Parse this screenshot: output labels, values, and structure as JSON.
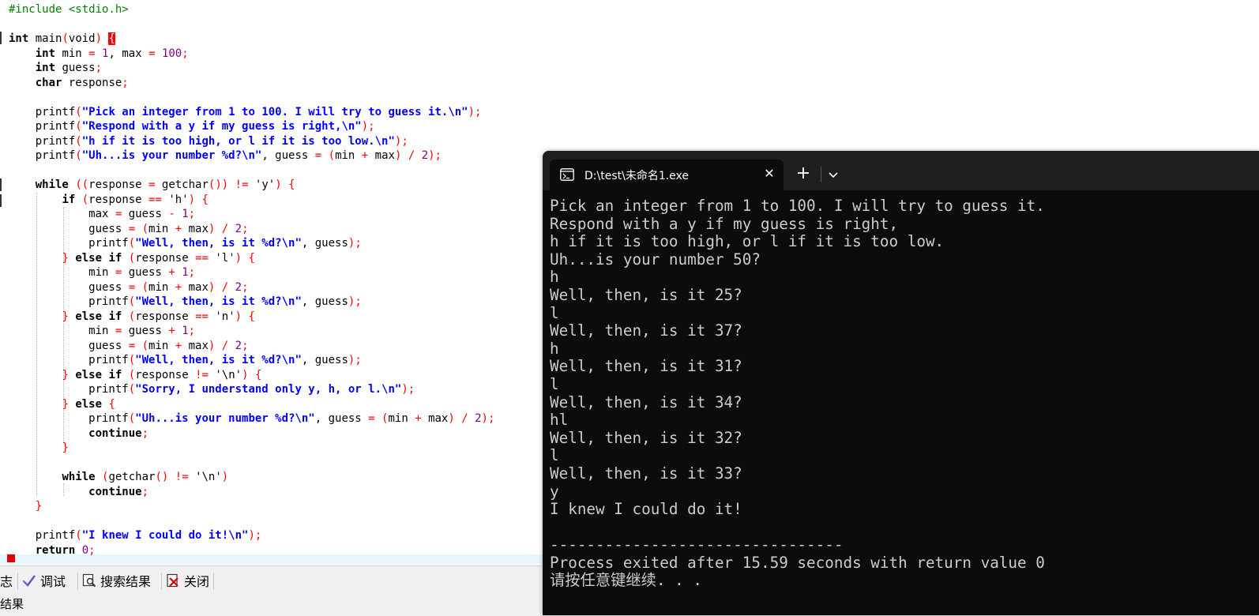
{
  "editor": {
    "lines": [
      [
        {
          "t": "#include <stdio.h>",
          "c": "pp"
        }
      ],
      [],
      [
        {
          "t": "int",
          "c": "kw"
        },
        {
          "t": " main"
        },
        {
          "t": "(",
          "c": "br"
        },
        {
          "t": "void"
        },
        {
          "t": ")",
          "c": "br"
        },
        {
          "t": " "
        },
        {
          "t": "{",
          "c": "brace-hl"
        }
      ],
      [
        {
          "t": "    "
        },
        {
          "t": "int",
          "c": "kw"
        },
        {
          "t": " min "
        },
        {
          "t": "=",
          "c": "op"
        },
        {
          "t": " "
        },
        {
          "t": "1",
          "c": "num"
        },
        {
          "t": ", max "
        },
        {
          "t": "=",
          "c": "op"
        },
        {
          "t": " "
        },
        {
          "t": "100",
          "c": "num"
        },
        {
          "t": ";",
          "c": "op"
        }
      ],
      [
        {
          "t": "    "
        },
        {
          "t": "int",
          "c": "kw"
        },
        {
          "t": " guess"
        },
        {
          "t": ";",
          "c": "op"
        }
      ],
      [
        {
          "t": "    "
        },
        {
          "t": "char",
          "c": "kw"
        },
        {
          "t": " response"
        },
        {
          "t": ";",
          "c": "op"
        }
      ],
      [],
      [
        {
          "t": "    printf"
        },
        {
          "t": "(",
          "c": "br"
        },
        {
          "t": "\"Pick an integer from 1 to 100. I will try to guess it.\\n\"",
          "c": "str"
        },
        {
          "t": ");",
          "c": "op"
        }
      ],
      [
        {
          "t": "    printf"
        },
        {
          "t": "(",
          "c": "br"
        },
        {
          "t": "\"Respond with a y if my guess is right,\\n\"",
          "c": "str"
        },
        {
          "t": ");",
          "c": "op"
        }
      ],
      [
        {
          "t": "    printf"
        },
        {
          "t": "(",
          "c": "br"
        },
        {
          "t": "\"h if it is too high, or l if it is too low.\\n\"",
          "c": "str"
        },
        {
          "t": ");",
          "c": "op"
        }
      ],
      [
        {
          "t": "    printf"
        },
        {
          "t": "(",
          "c": "br"
        },
        {
          "t": "\"Uh...is your number %d?\\n\"",
          "c": "str"
        },
        {
          "t": ", guess "
        },
        {
          "t": "=",
          "c": "op"
        },
        {
          "t": " "
        },
        {
          "t": "(",
          "c": "br"
        },
        {
          "t": "min "
        },
        {
          "t": "+",
          "c": "op"
        },
        {
          "t": " max"
        },
        {
          "t": ")",
          "c": "br"
        },
        {
          "t": " "
        },
        {
          "t": "/",
          "c": "op"
        },
        {
          "t": " "
        },
        {
          "t": "2",
          "c": "num"
        },
        {
          "t": ");",
          "c": "op"
        }
      ],
      [],
      [
        {
          "t": "    "
        },
        {
          "t": "while",
          "c": "kw"
        },
        {
          "t": " "
        },
        {
          "t": "((",
          "c": "br"
        },
        {
          "t": "response "
        },
        {
          "t": "=",
          "c": "op"
        },
        {
          "t": " getchar"
        },
        {
          "t": "())",
          "c": "br"
        },
        {
          "t": " "
        },
        {
          "t": "!=",
          "c": "op"
        },
        {
          "t": " 'y'"
        },
        {
          "t": ")",
          "c": "br"
        },
        {
          "t": " "
        },
        {
          "t": "{",
          "c": "br"
        }
      ],
      [
        {
          "t": "        "
        },
        {
          "t": "if",
          "c": "kw"
        },
        {
          "t": " "
        },
        {
          "t": "(",
          "c": "br"
        },
        {
          "t": "response "
        },
        {
          "t": "==",
          "c": "op"
        },
        {
          "t": " 'h'"
        },
        {
          "t": ")",
          "c": "br"
        },
        {
          "t": " "
        },
        {
          "t": "{",
          "c": "br"
        }
      ],
      [
        {
          "t": "            max "
        },
        {
          "t": "=",
          "c": "op"
        },
        {
          "t": " guess "
        },
        {
          "t": "-",
          "c": "op"
        },
        {
          "t": " "
        },
        {
          "t": "1",
          "c": "num"
        },
        {
          "t": ";",
          "c": "op"
        }
      ],
      [
        {
          "t": "            guess "
        },
        {
          "t": "=",
          "c": "op"
        },
        {
          "t": " "
        },
        {
          "t": "(",
          "c": "br"
        },
        {
          "t": "min "
        },
        {
          "t": "+",
          "c": "op"
        },
        {
          "t": " max"
        },
        {
          "t": ")",
          "c": "br"
        },
        {
          "t": " "
        },
        {
          "t": "/",
          "c": "op"
        },
        {
          "t": " "
        },
        {
          "t": "2",
          "c": "num"
        },
        {
          "t": ";",
          "c": "op"
        }
      ],
      [
        {
          "t": "            printf"
        },
        {
          "t": "(",
          "c": "br"
        },
        {
          "t": "\"Well, then, is it %d?\\n\"",
          "c": "str"
        },
        {
          "t": ", guess"
        },
        {
          "t": ");",
          "c": "op"
        }
      ],
      [
        {
          "t": "        "
        },
        {
          "t": "}",
          "c": "br"
        },
        {
          "t": " "
        },
        {
          "t": "else if",
          "c": "kw"
        },
        {
          "t": " "
        },
        {
          "t": "(",
          "c": "br"
        },
        {
          "t": "response "
        },
        {
          "t": "==",
          "c": "op"
        },
        {
          "t": " 'l'"
        },
        {
          "t": ")",
          "c": "br"
        },
        {
          "t": " "
        },
        {
          "t": "{",
          "c": "br"
        }
      ],
      [
        {
          "t": "            min "
        },
        {
          "t": "=",
          "c": "op"
        },
        {
          "t": " guess "
        },
        {
          "t": "+",
          "c": "op"
        },
        {
          "t": " "
        },
        {
          "t": "1",
          "c": "num"
        },
        {
          "t": ";",
          "c": "op"
        }
      ],
      [
        {
          "t": "            guess "
        },
        {
          "t": "=",
          "c": "op"
        },
        {
          "t": " "
        },
        {
          "t": "(",
          "c": "br"
        },
        {
          "t": "min "
        },
        {
          "t": "+",
          "c": "op"
        },
        {
          "t": " max"
        },
        {
          "t": ")",
          "c": "br"
        },
        {
          "t": " "
        },
        {
          "t": "/",
          "c": "op"
        },
        {
          "t": " "
        },
        {
          "t": "2",
          "c": "num"
        },
        {
          "t": ";",
          "c": "op"
        }
      ],
      [
        {
          "t": "            printf"
        },
        {
          "t": "(",
          "c": "br"
        },
        {
          "t": "\"Well, then, is it %d?\\n\"",
          "c": "str"
        },
        {
          "t": ", guess"
        },
        {
          "t": ");",
          "c": "op"
        }
      ],
      [
        {
          "t": "        "
        },
        {
          "t": "}",
          "c": "br"
        },
        {
          "t": " "
        },
        {
          "t": "else if",
          "c": "kw"
        },
        {
          "t": " "
        },
        {
          "t": "(",
          "c": "br"
        },
        {
          "t": "response "
        },
        {
          "t": "==",
          "c": "op"
        },
        {
          "t": " 'n'"
        },
        {
          "t": ")",
          "c": "br"
        },
        {
          "t": " "
        },
        {
          "t": "{",
          "c": "br"
        }
      ],
      [
        {
          "t": "            min "
        },
        {
          "t": "=",
          "c": "op"
        },
        {
          "t": " guess "
        },
        {
          "t": "+",
          "c": "op"
        },
        {
          "t": " "
        },
        {
          "t": "1",
          "c": "num"
        },
        {
          "t": ";",
          "c": "op"
        }
      ],
      [
        {
          "t": "            guess "
        },
        {
          "t": "=",
          "c": "op"
        },
        {
          "t": " "
        },
        {
          "t": "(",
          "c": "br"
        },
        {
          "t": "min "
        },
        {
          "t": "+",
          "c": "op"
        },
        {
          "t": " max"
        },
        {
          "t": ")",
          "c": "br"
        },
        {
          "t": " "
        },
        {
          "t": "/",
          "c": "op"
        },
        {
          "t": " "
        },
        {
          "t": "2",
          "c": "num"
        },
        {
          "t": ";",
          "c": "op"
        }
      ],
      [
        {
          "t": "            printf"
        },
        {
          "t": "(",
          "c": "br"
        },
        {
          "t": "\"Well, then, is it %d?\\n\"",
          "c": "str"
        },
        {
          "t": ", guess"
        },
        {
          "t": ");",
          "c": "op"
        }
      ],
      [
        {
          "t": "        "
        },
        {
          "t": "}",
          "c": "br"
        },
        {
          "t": " "
        },
        {
          "t": "else if",
          "c": "kw"
        },
        {
          "t": " "
        },
        {
          "t": "(",
          "c": "br"
        },
        {
          "t": "response "
        },
        {
          "t": "!=",
          "c": "op"
        },
        {
          "t": " '\\n'"
        },
        {
          "t": ")",
          "c": "br"
        },
        {
          "t": " "
        },
        {
          "t": "{",
          "c": "br"
        }
      ],
      [
        {
          "t": "            printf"
        },
        {
          "t": "(",
          "c": "br"
        },
        {
          "t": "\"Sorry, I understand only y, h, or l.\\n\"",
          "c": "str"
        },
        {
          "t": ");",
          "c": "op"
        }
      ],
      [
        {
          "t": "        "
        },
        {
          "t": "}",
          "c": "br"
        },
        {
          "t": " "
        },
        {
          "t": "else",
          "c": "kw"
        },
        {
          "t": " "
        },
        {
          "t": "{",
          "c": "br"
        }
      ],
      [
        {
          "t": "            printf"
        },
        {
          "t": "(",
          "c": "br"
        },
        {
          "t": "\"Uh...is your number %d?\\n\"",
          "c": "str"
        },
        {
          "t": ", guess "
        },
        {
          "t": "=",
          "c": "op"
        },
        {
          "t": " "
        },
        {
          "t": "(",
          "c": "br"
        },
        {
          "t": "min "
        },
        {
          "t": "+",
          "c": "op"
        },
        {
          "t": " max"
        },
        {
          "t": ")",
          "c": "br"
        },
        {
          "t": " "
        },
        {
          "t": "/",
          "c": "op"
        },
        {
          "t": " "
        },
        {
          "t": "2",
          "c": "num"
        },
        {
          "t": ");",
          "c": "op"
        }
      ],
      [
        {
          "t": "            "
        },
        {
          "t": "continue",
          "c": "kw"
        },
        {
          "t": ";",
          "c": "op"
        }
      ],
      [
        {
          "t": "        "
        },
        {
          "t": "}",
          "c": "br"
        }
      ],
      [],
      [
        {
          "t": "        "
        },
        {
          "t": "while",
          "c": "kw"
        },
        {
          "t": " "
        },
        {
          "t": "(",
          "c": "br"
        },
        {
          "t": "getchar"
        },
        {
          "t": "()",
          "c": "br"
        },
        {
          "t": " "
        },
        {
          "t": "!=",
          "c": "op"
        },
        {
          "t": " '\\n'"
        },
        {
          "t": ")",
          "c": "br"
        }
      ],
      [
        {
          "t": "            "
        },
        {
          "t": "continue",
          "c": "kw"
        },
        {
          "t": ";",
          "c": "op"
        }
      ],
      [
        {
          "t": "    "
        },
        {
          "t": "}",
          "c": "br"
        }
      ],
      [],
      [
        {
          "t": "    printf"
        },
        {
          "t": "(",
          "c": "br"
        },
        {
          "t": "\"I knew I could do it!\\n\"",
          "c": "str"
        },
        {
          "t": ");",
          "c": "op"
        }
      ],
      [
        {
          "t": "    "
        },
        {
          "t": "return",
          "c": "kw"
        },
        {
          "t": " "
        },
        {
          "t": "0",
          "c": "num"
        },
        {
          "t": ";",
          "c": "op"
        }
      ]
    ]
  },
  "bottom_panel": {
    "tabs": [
      {
        "label": "志",
        "icon": "log-icon"
      },
      {
        "label": "调试",
        "icon": "debug-check-icon"
      },
      {
        "label": "搜索结果",
        "icon": "search-results-icon"
      },
      {
        "label": "关闭",
        "icon": "close-doc-icon"
      }
    ],
    "results_label": "结果"
  },
  "terminal": {
    "tab_title": "D:\\test\\未命名1.exe",
    "close_glyph": "✕",
    "new_tab_glyph": "+",
    "output_lines": [
      "Pick an integer from 1 to 100. I will try to guess it.",
      "Respond with a y if my guess is right,",
      "h if it is too high, or l if it is too low.",
      "Uh...is your number 50?",
      "h",
      "Well, then, is it 25?",
      "l",
      "Well, then, is it 37?",
      "h",
      "Well, then, is it 31?",
      "l",
      "Well, then, is it 34?",
      "hl",
      "Well, then, is it 32?",
      "l",
      "Well, then, is it 33?",
      "y",
      "I knew I could do it!",
      "",
      "--------------------------------",
      "Process exited after 15.59 seconds with return value 0",
      "请按任意键继续. . ."
    ]
  }
}
